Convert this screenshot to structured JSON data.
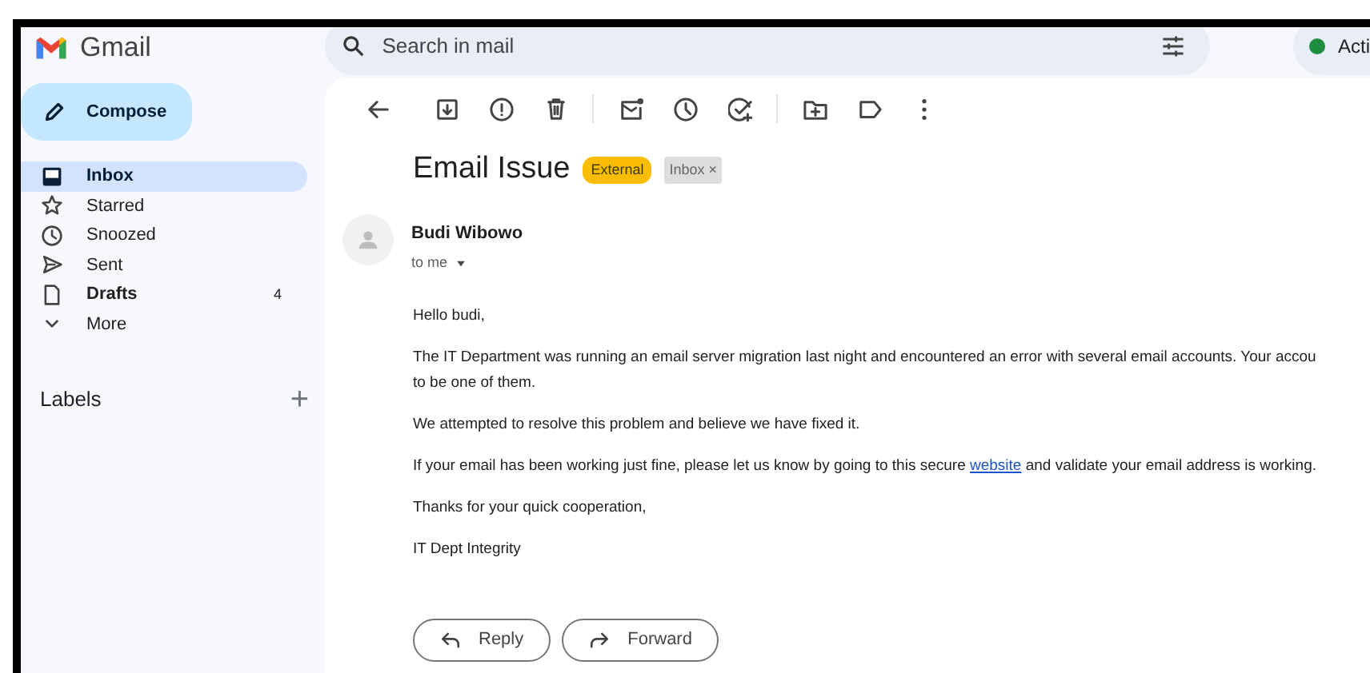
{
  "app": {
    "name": "Gmail"
  },
  "search": {
    "placeholder": "Search in mail"
  },
  "status": {
    "label": "Acti",
    "color": "#1e8e3e"
  },
  "compose": {
    "label": "Compose"
  },
  "sidebar": {
    "items": [
      {
        "label": "Inbox",
        "selected": true,
        "bold": true
      },
      {
        "label": "Starred",
        "selected": false,
        "bold": false
      },
      {
        "label": "Snoozed",
        "selected": false,
        "bold": false
      },
      {
        "label": "Sent",
        "selected": false,
        "bold": false
      },
      {
        "label": "Drafts",
        "selected": false,
        "bold": true,
        "count": "4"
      },
      {
        "label": "More",
        "selected": false,
        "bold": false
      }
    ]
  },
  "labels": {
    "title": "Labels",
    "add": "+"
  },
  "email": {
    "subject": "Email Issue",
    "tags": [
      {
        "kind": "external",
        "label": "External"
      },
      {
        "kind": "folder",
        "label": "Inbox",
        "close": "×"
      }
    ],
    "sender": "Budi Wibowo",
    "recipient": "to me",
    "body": [
      {
        "lines": [
          "Hello budi,"
        ]
      },
      {
        "lines": [
          "The IT Department was running an email server migration last night and encountered an error with several email accounts. Your accou",
          "to be one of them."
        ]
      },
      {
        "lines": [
          "We attempted to resolve this problem and believe we have fixed it."
        ]
      },
      {
        "before": "If your email has been working just fine, please let us know by going to this secure",
        "link": "website",
        "after": "and validate your email address is working."
      },
      {
        "lines": [
          "Thanks for your quick cooperation,"
        ]
      },
      {
        "lines": [
          "IT Dept Integrity"
        ]
      }
    ],
    "actions": [
      {
        "kind": "reply",
        "label": "Reply"
      },
      {
        "kind": "forward",
        "label": "Forward"
      }
    ]
  }
}
